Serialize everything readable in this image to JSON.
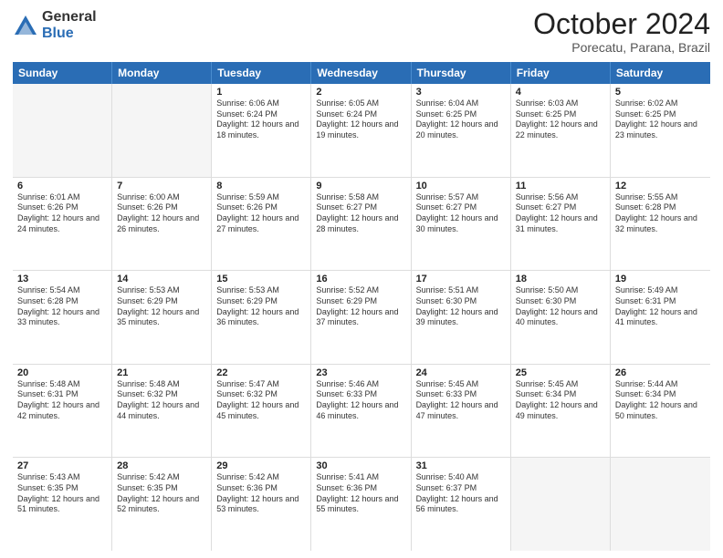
{
  "header": {
    "logo_general": "General",
    "logo_blue": "Blue",
    "month_title": "October 2024",
    "location": "Porecatu, Parana, Brazil"
  },
  "calendar": {
    "days_of_week": [
      "Sunday",
      "Monday",
      "Tuesday",
      "Wednesday",
      "Thursday",
      "Friday",
      "Saturday"
    ],
    "weeks": [
      [
        {
          "day": "",
          "sunrise": "",
          "sunset": "",
          "daylight": "",
          "empty": true
        },
        {
          "day": "",
          "sunrise": "",
          "sunset": "",
          "daylight": "",
          "empty": true
        },
        {
          "day": "1",
          "sunrise": "Sunrise: 6:06 AM",
          "sunset": "Sunset: 6:24 PM",
          "daylight": "Daylight: 12 hours and 18 minutes.",
          "empty": false
        },
        {
          "day": "2",
          "sunrise": "Sunrise: 6:05 AM",
          "sunset": "Sunset: 6:24 PM",
          "daylight": "Daylight: 12 hours and 19 minutes.",
          "empty": false
        },
        {
          "day": "3",
          "sunrise": "Sunrise: 6:04 AM",
          "sunset": "Sunset: 6:25 PM",
          "daylight": "Daylight: 12 hours and 20 minutes.",
          "empty": false
        },
        {
          "day": "4",
          "sunrise": "Sunrise: 6:03 AM",
          "sunset": "Sunset: 6:25 PM",
          "daylight": "Daylight: 12 hours and 22 minutes.",
          "empty": false
        },
        {
          "day": "5",
          "sunrise": "Sunrise: 6:02 AM",
          "sunset": "Sunset: 6:25 PM",
          "daylight": "Daylight: 12 hours and 23 minutes.",
          "empty": false
        }
      ],
      [
        {
          "day": "6",
          "sunrise": "Sunrise: 6:01 AM",
          "sunset": "Sunset: 6:26 PM",
          "daylight": "Daylight: 12 hours and 24 minutes.",
          "empty": false
        },
        {
          "day": "7",
          "sunrise": "Sunrise: 6:00 AM",
          "sunset": "Sunset: 6:26 PM",
          "daylight": "Daylight: 12 hours and 26 minutes.",
          "empty": false
        },
        {
          "day": "8",
          "sunrise": "Sunrise: 5:59 AM",
          "sunset": "Sunset: 6:26 PM",
          "daylight": "Daylight: 12 hours and 27 minutes.",
          "empty": false
        },
        {
          "day": "9",
          "sunrise": "Sunrise: 5:58 AM",
          "sunset": "Sunset: 6:27 PM",
          "daylight": "Daylight: 12 hours and 28 minutes.",
          "empty": false
        },
        {
          "day": "10",
          "sunrise": "Sunrise: 5:57 AM",
          "sunset": "Sunset: 6:27 PM",
          "daylight": "Daylight: 12 hours and 30 minutes.",
          "empty": false
        },
        {
          "day": "11",
          "sunrise": "Sunrise: 5:56 AM",
          "sunset": "Sunset: 6:27 PM",
          "daylight": "Daylight: 12 hours and 31 minutes.",
          "empty": false
        },
        {
          "day": "12",
          "sunrise": "Sunrise: 5:55 AM",
          "sunset": "Sunset: 6:28 PM",
          "daylight": "Daylight: 12 hours and 32 minutes.",
          "empty": false
        }
      ],
      [
        {
          "day": "13",
          "sunrise": "Sunrise: 5:54 AM",
          "sunset": "Sunset: 6:28 PM",
          "daylight": "Daylight: 12 hours and 33 minutes.",
          "empty": false
        },
        {
          "day": "14",
          "sunrise": "Sunrise: 5:53 AM",
          "sunset": "Sunset: 6:29 PM",
          "daylight": "Daylight: 12 hours and 35 minutes.",
          "empty": false
        },
        {
          "day": "15",
          "sunrise": "Sunrise: 5:53 AM",
          "sunset": "Sunset: 6:29 PM",
          "daylight": "Daylight: 12 hours and 36 minutes.",
          "empty": false
        },
        {
          "day": "16",
          "sunrise": "Sunrise: 5:52 AM",
          "sunset": "Sunset: 6:29 PM",
          "daylight": "Daylight: 12 hours and 37 minutes.",
          "empty": false
        },
        {
          "day": "17",
          "sunrise": "Sunrise: 5:51 AM",
          "sunset": "Sunset: 6:30 PM",
          "daylight": "Daylight: 12 hours and 39 minutes.",
          "empty": false
        },
        {
          "day": "18",
          "sunrise": "Sunrise: 5:50 AM",
          "sunset": "Sunset: 6:30 PM",
          "daylight": "Daylight: 12 hours and 40 minutes.",
          "empty": false
        },
        {
          "day": "19",
          "sunrise": "Sunrise: 5:49 AM",
          "sunset": "Sunset: 6:31 PM",
          "daylight": "Daylight: 12 hours and 41 minutes.",
          "empty": false
        }
      ],
      [
        {
          "day": "20",
          "sunrise": "Sunrise: 5:48 AM",
          "sunset": "Sunset: 6:31 PM",
          "daylight": "Daylight: 12 hours and 42 minutes.",
          "empty": false
        },
        {
          "day": "21",
          "sunrise": "Sunrise: 5:48 AM",
          "sunset": "Sunset: 6:32 PM",
          "daylight": "Daylight: 12 hours and 44 minutes.",
          "empty": false
        },
        {
          "day": "22",
          "sunrise": "Sunrise: 5:47 AM",
          "sunset": "Sunset: 6:32 PM",
          "daylight": "Daylight: 12 hours and 45 minutes.",
          "empty": false
        },
        {
          "day": "23",
          "sunrise": "Sunrise: 5:46 AM",
          "sunset": "Sunset: 6:33 PM",
          "daylight": "Daylight: 12 hours and 46 minutes.",
          "empty": false
        },
        {
          "day": "24",
          "sunrise": "Sunrise: 5:45 AM",
          "sunset": "Sunset: 6:33 PM",
          "daylight": "Daylight: 12 hours and 47 minutes.",
          "empty": false
        },
        {
          "day": "25",
          "sunrise": "Sunrise: 5:45 AM",
          "sunset": "Sunset: 6:34 PM",
          "daylight": "Daylight: 12 hours and 49 minutes.",
          "empty": false
        },
        {
          "day": "26",
          "sunrise": "Sunrise: 5:44 AM",
          "sunset": "Sunset: 6:34 PM",
          "daylight": "Daylight: 12 hours and 50 minutes.",
          "empty": false
        }
      ],
      [
        {
          "day": "27",
          "sunrise": "Sunrise: 5:43 AM",
          "sunset": "Sunset: 6:35 PM",
          "daylight": "Daylight: 12 hours and 51 minutes.",
          "empty": false
        },
        {
          "day": "28",
          "sunrise": "Sunrise: 5:42 AM",
          "sunset": "Sunset: 6:35 PM",
          "daylight": "Daylight: 12 hours and 52 minutes.",
          "empty": false
        },
        {
          "day": "29",
          "sunrise": "Sunrise: 5:42 AM",
          "sunset": "Sunset: 6:36 PM",
          "daylight": "Daylight: 12 hours and 53 minutes.",
          "empty": false
        },
        {
          "day": "30",
          "sunrise": "Sunrise: 5:41 AM",
          "sunset": "Sunset: 6:36 PM",
          "daylight": "Daylight: 12 hours and 55 minutes.",
          "empty": false
        },
        {
          "day": "31",
          "sunrise": "Sunrise: 5:40 AM",
          "sunset": "Sunset: 6:37 PM",
          "daylight": "Daylight: 12 hours and 56 minutes.",
          "empty": false
        },
        {
          "day": "",
          "sunrise": "",
          "sunset": "",
          "daylight": "",
          "empty": true
        },
        {
          "day": "",
          "sunrise": "",
          "sunset": "",
          "daylight": "",
          "empty": true
        }
      ]
    ]
  }
}
